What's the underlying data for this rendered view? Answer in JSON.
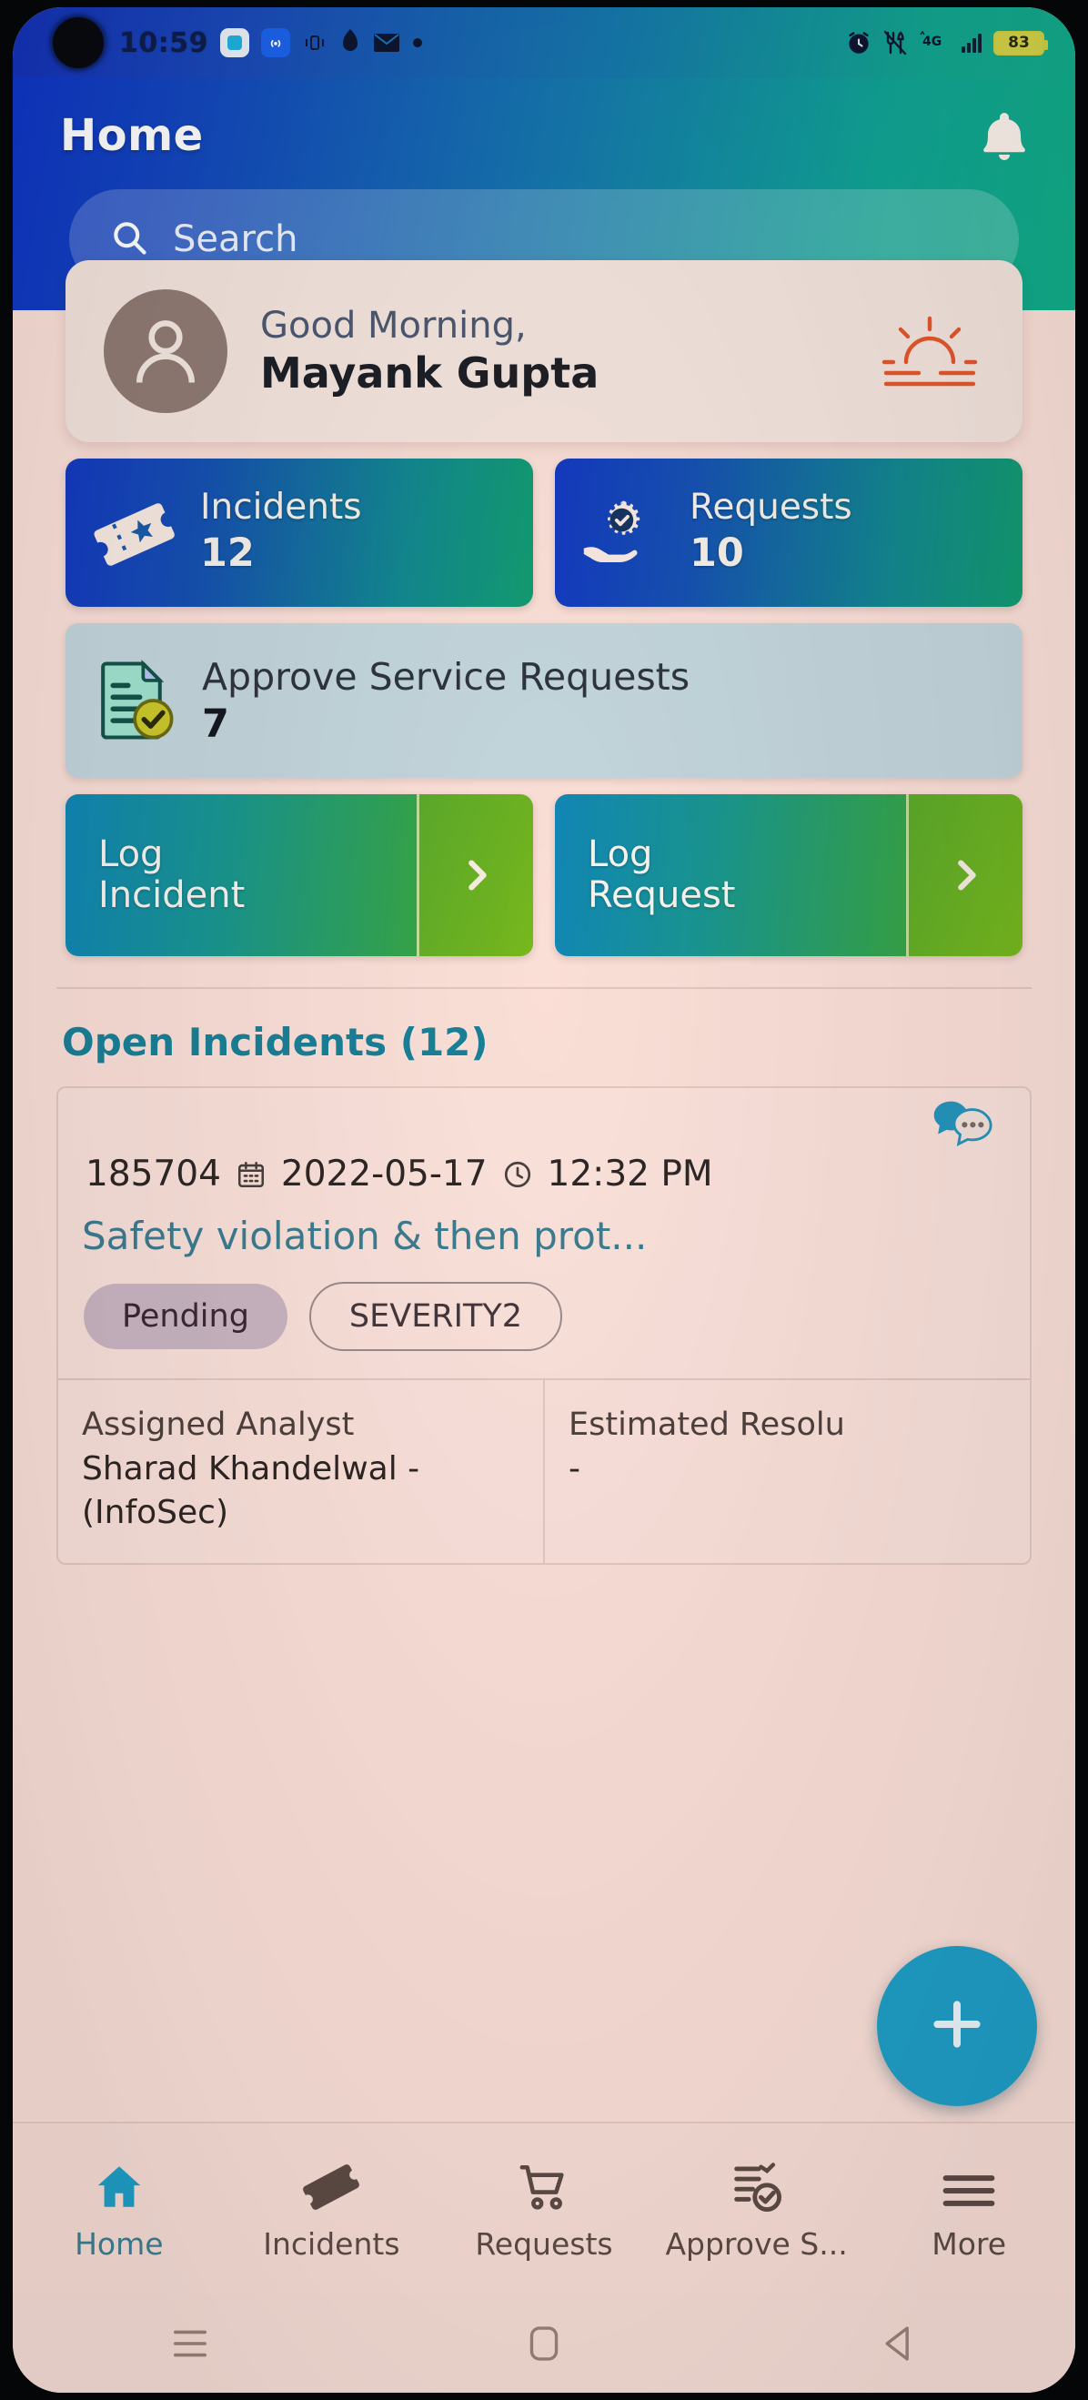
{
  "status_bar": {
    "time": "10:59",
    "battery_percent": "83",
    "icons": [
      "camera-punch-hole",
      "screenshot-icon",
      "hotspot-icon",
      "vibrate-icon",
      "app-icon",
      "mail-icon",
      "dot-icon",
      "alarm-icon",
      "do-not-disturb-icon",
      "signal-4g-icon",
      "signal-bars-icon",
      "battery-icon"
    ]
  },
  "header": {
    "title": "Home",
    "bell_icon": "bell-icon"
  },
  "search": {
    "placeholder": "Search",
    "icon": "search-icon"
  },
  "greeting": {
    "salutation": "Good Morning,",
    "name": "Mayank Gupta",
    "avatar_icon": "user-avatar-icon",
    "weather_icon": "sunrise-icon"
  },
  "tiles": [
    {
      "label": "Incidents",
      "count": "12",
      "icon": "ticket-icon"
    },
    {
      "label": "Requests",
      "count": "10",
      "icon": "gear-hand-icon"
    }
  ],
  "approve_card": {
    "title": "Approve Service Requests",
    "count": "7",
    "icon": "document-check-icon"
  },
  "log_buttons": [
    {
      "label_line1": "Log",
      "label_line2": "Incident",
      "arrow_icon": "chevron-right-icon"
    },
    {
      "label_line1": "Log",
      "label_line2": "Request",
      "arrow_icon": "chevron-right-icon"
    }
  ],
  "open_incidents": {
    "section_title": "Open Incidents (12)",
    "card": {
      "id": "185704",
      "date": "2022-05-17",
      "time": "12:32 PM",
      "date_icon": "calendar-icon",
      "time_icon": "clock-icon",
      "chat_icon": "chat-bubbles-icon",
      "title": "Safety violation & then prot...",
      "status_badge": "Pending",
      "severity_badge": "SEVERITY2",
      "columns": [
        {
          "label": "Assigned Analyst",
          "value": "Sharad Khandelwal - (InfoSec)"
        },
        {
          "label": "Estimated Resolu",
          "value": "-"
        }
      ]
    }
  },
  "fab": {
    "icon": "plus-icon",
    "color": "#1f9ec7"
  },
  "bottom_nav": [
    {
      "label": "Home",
      "icon": "home-icon",
      "active": true
    },
    {
      "label": "Incidents",
      "icon": "ticket-icon",
      "active": false
    },
    {
      "label": "Requests",
      "icon": "cart-icon",
      "active": false
    },
    {
      "label": "Approve S...",
      "icon": "approve-list-icon",
      "active": false
    },
    {
      "label": "More",
      "icon": "hamburger-icon",
      "active": false
    }
  ],
  "system_nav": [
    {
      "icon": "recent-apps-icon"
    },
    {
      "icon": "home-square-icon"
    },
    {
      "icon": "back-triangle-icon"
    }
  ],
  "colors": {
    "header_gradient_start": "#0f35c5",
    "header_gradient_end": "#12ad87",
    "page_background": "#fadfd7",
    "accent": "#1f9ec7",
    "section_title": "#1a7f96",
    "approve_card_bg": "#c3d6dc"
  }
}
